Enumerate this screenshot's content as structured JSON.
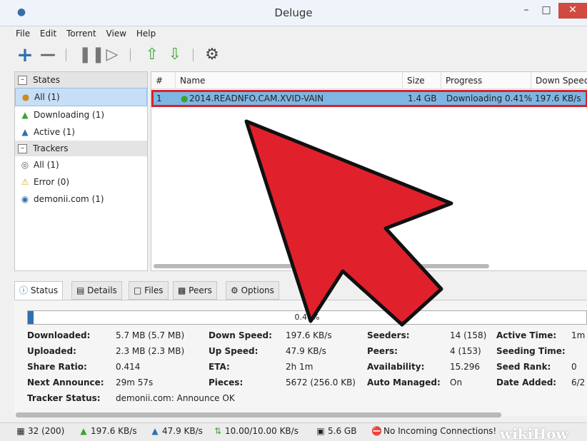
{
  "window": {
    "title": "Deluge",
    "controls": {
      "min": "–",
      "max": "□",
      "close": "✕"
    }
  },
  "menu": [
    "File",
    "Edit",
    "Torrent",
    "View",
    "Help"
  ],
  "toolbar": [
    "add-icon",
    "remove-icon",
    "pause-icon",
    "resume-icon",
    "queue-up-icon",
    "queue-down-icon",
    "preferences-icon"
  ],
  "sidebar": {
    "states_header": "States",
    "states": [
      {
        "label": "All (1)",
        "icon": "all-icon"
      },
      {
        "label": "Downloading (1)",
        "icon": "downloading-icon"
      },
      {
        "label": "Active (1)",
        "icon": "active-icon"
      }
    ],
    "trackers_header": "Trackers",
    "trackers": [
      {
        "label": "All (1)",
        "icon": "globe-icon"
      },
      {
        "label": "Error (0)",
        "icon": "warning-icon"
      },
      {
        "label": "demonii.com (1)",
        "icon": "tracker-icon"
      }
    ]
  },
  "columns": [
    "#",
    "Name",
    "Size",
    "Progress",
    "Down Speed"
  ],
  "torrents": [
    {
      "num": "1",
      "name": "2014.READNFO.CAM.XVID-VAIN",
      "size": "1.4 GB",
      "progress": "Downloading 0.41%",
      "down_speed": "197.6 KB/s"
    }
  ],
  "tabs": [
    "Status",
    "Details",
    "Files",
    "Peers",
    "Options"
  ],
  "status": {
    "progress_label": "0.41%",
    "progress_fraction": 0.0041,
    "col1": [
      {
        "label": "Downloaded:",
        "value": "5.7 MB (5.7 MB)"
      },
      {
        "label": "Uploaded:",
        "value": "2.3 MB (2.3 MB)"
      },
      {
        "label": "Share Ratio:",
        "value": "0.414"
      },
      {
        "label": "Next Announce:",
        "value": "29m 57s"
      },
      {
        "label": "Tracker Status:",
        "value": "demonii.com: Announce OK"
      }
    ],
    "col2": [
      {
        "label": "Down Speed:",
        "value": "197.6 KB/s"
      },
      {
        "label": "Up Speed:",
        "value": "47.9 KB/s"
      },
      {
        "label": "ETA:",
        "value": "2h 1m"
      },
      {
        "label": "Pieces:",
        "value": "5672 (256.0 KB)"
      }
    ],
    "col3": [
      {
        "label": "Seeders:",
        "value": "14 (158)"
      },
      {
        "label": "Peers:",
        "value": "4 (153)"
      },
      {
        "label": "Availability:",
        "value": "15.296"
      },
      {
        "label": "Auto Managed:",
        "value": "On"
      }
    ],
    "col4": [
      {
        "label": "Active Time:",
        "value": "1m"
      },
      {
        "label": "Seeding Time:",
        "value": ""
      },
      {
        "label": "Seed Rank:",
        "value": "0"
      },
      {
        "label": "Date Added:",
        "value": "6/2"
      }
    ]
  },
  "statusbar": {
    "connections": "32 (200)",
    "down": "197.6 KB/s",
    "up": "47.9 KB/s",
    "proto": "10.00/10.00 KB/s",
    "disk": "5.6 GB",
    "incoming": "No Incoming Connections!"
  },
  "watermark": "wikiHow"
}
